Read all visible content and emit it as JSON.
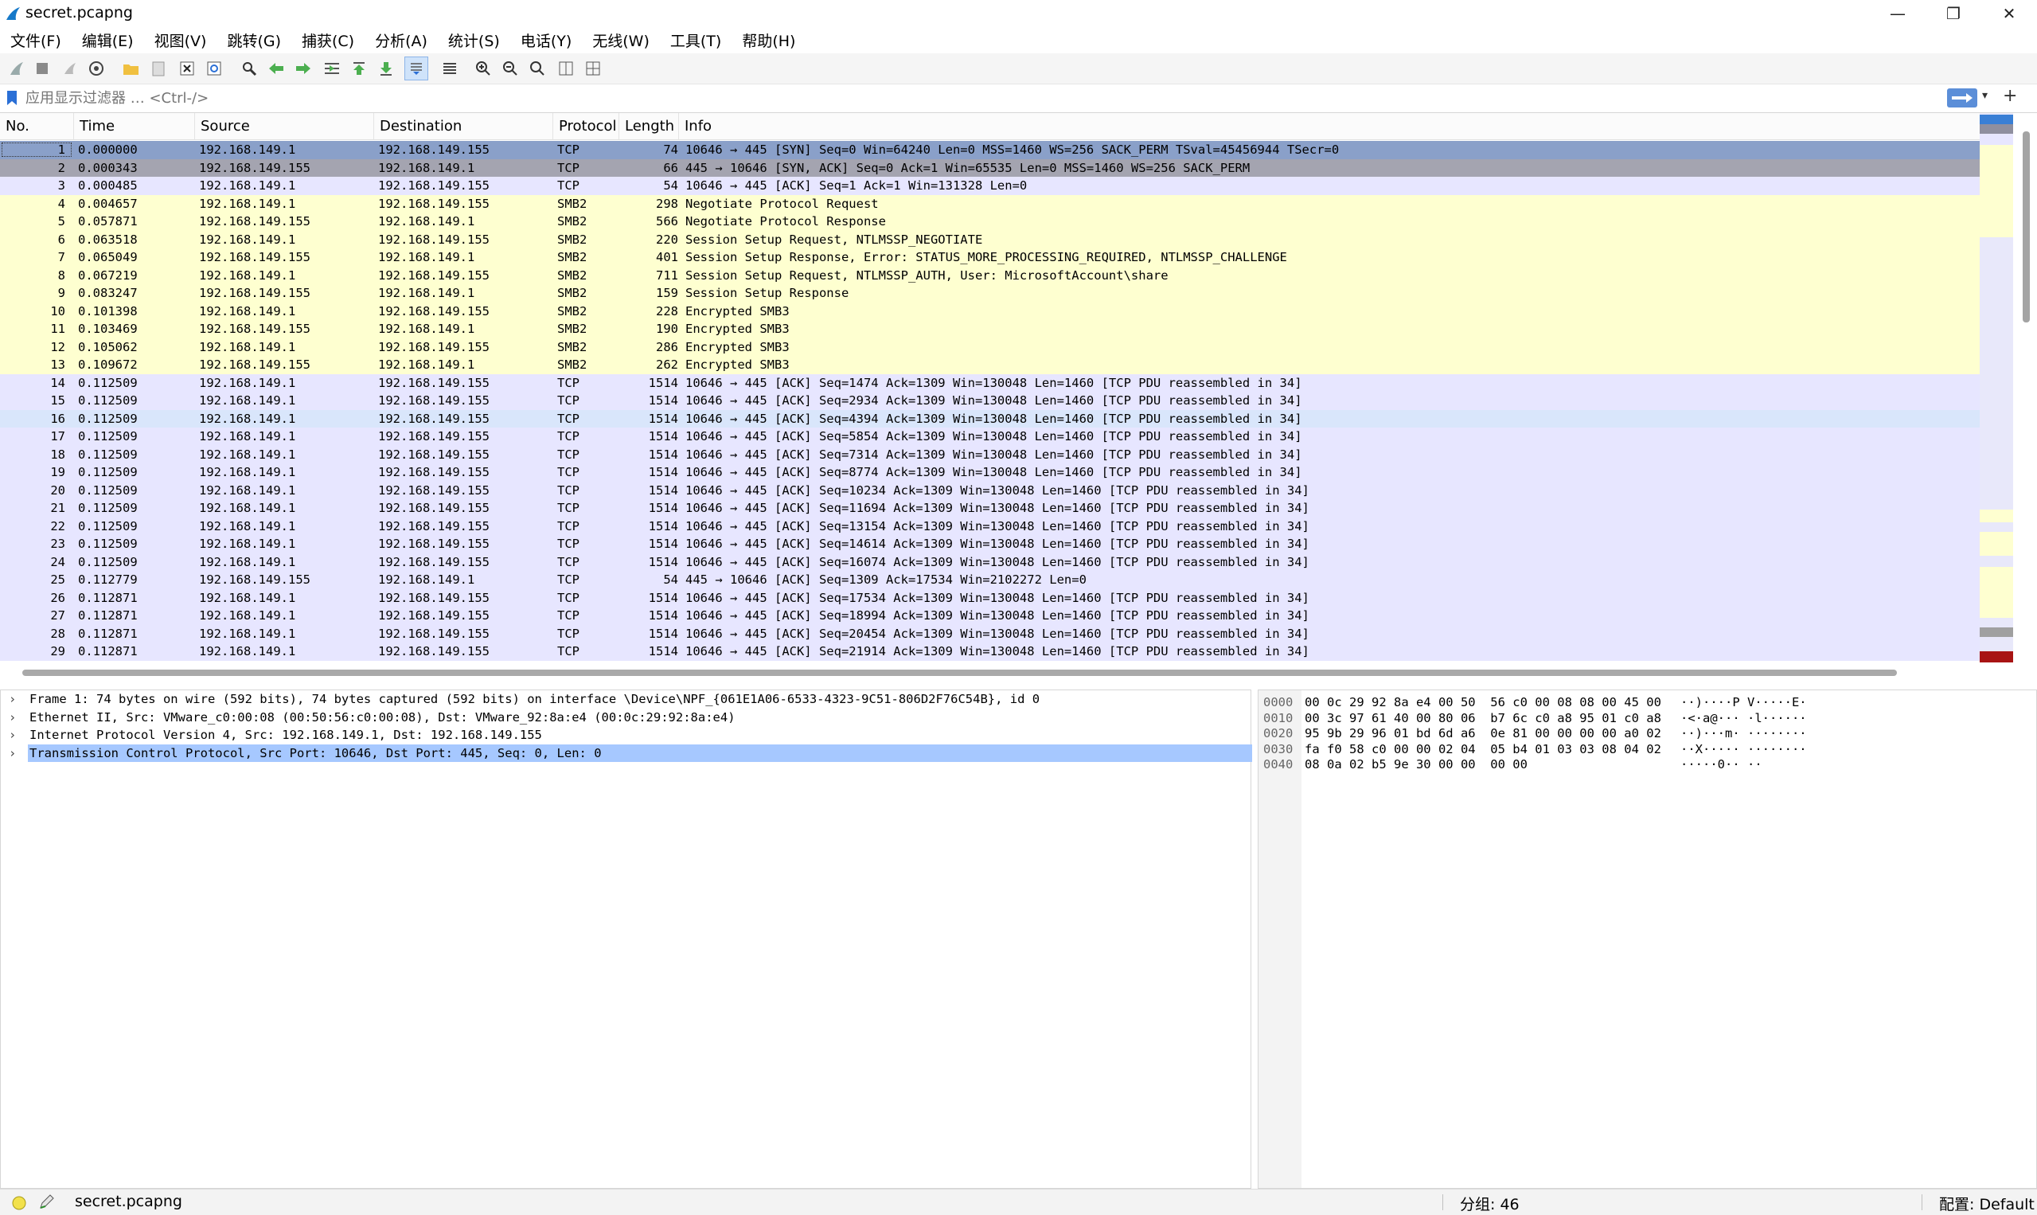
{
  "window": {
    "title": "secret.pcapng",
    "minimize": "—",
    "maximize": "❐",
    "close": "✕"
  },
  "menu": [
    "文件(F)",
    "编辑(E)",
    "视图(V)",
    "跳转(G)",
    "捕获(C)",
    "分析(A)",
    "统计(S)",
    "电话(Y)",
    "无线(W)",
    "工具(T)",
    "帮助(H)"
  ],
  "toolbar_icons": [
    "shark-fin-start-icon",
    "stop-icon",
    "restart-icon",
    "capture-options-icon",
    "open-folder-icon",
    "save-file-icon",
    "close-file-icon",
    "reload-icon",
    "find-icon",
    "back-arrow-icon",
    "forward-arrow-icon",
    "goto-packet-icon",
    "first-packet-icon",
    "last-packet-icon",
    "autoscroll-icon",
    "colorize-icon",
    "zoom-in-icon",
    "zoom-out-icon",
    "zoom-normal-icon",
    "resize-columns-icon",
    "layout-icon"
  ],
  "filter": {
    "placeholder": "应用显示过滤器 … <Ctrl-/>",
    "plus": "+"
  },
  "columns": {
    "no": "No.",
    "time": "Time",
    "source": "Source",
    "destination": "Destination",
    "protocol": "Protocol",
    "length": "Length",
    "info": "Info"
  },
  "packets": [
    {
      "no": "1",
      "time": "0.000000",
      "src": "192.168.149.1",
      "dst": "192.168.149.155",
      "proto": "TCP",
      "len": "74",
      "info": "10646 → 445 [SYN] Seq=0 Win=64240 Len=0 MSS=1460 WS=256 SACK_PERM TSval=45456944 TSecr=0"
    },
    {
      "no": "2",
      "time": "0.000343",
      "src": "192.168.149.155",
      "dst": "192.168.149.1",
      "proto": "TCP",
      "len": "66",
      "info": "445 → 10646 [SYN, ACK] Seq=0 Ack=1 Win=65535 Len=0 MSS=1460 WS=256 SACK_PERM"
    },
    {
      "no": "3",
      "time": "0.000485",
      "src": "192.168.149.1",
      "dst": "192.168.149.155",
      "proto": "TCP",
      "len": "54",
      "info": "10646 → 445 [ACK] Seq=1 Ack=1 Win=131328 Len=0"
    },
    {
      "no": "4",
      "time": "0.004657",
      "src": "192.168.149.1",
      "dst": "192.168.149.155",
      "proto": "SMB2",
      "len": "298",
      "info": "Negotiate Protocol Request"
    },
    {
      "no": "5",
      "time": "0.057871",
      "src": "192.168.149.155",
      "dst": "192.168.149.1",
      "proto": "SMB2",
      "len": "566",
      "info": "Negotiate Protocol Response"
    },
    {
      "no": "6",
      "time": "0.063518",
      "src": "192.168.149.1",
      "dst": "192.168.149.155",
      "proto": "SMB2",
      "len": "220",
      "info": "Session Setup Request, NTLMSSP_NEGOTIATE"
    },
    {
      "no": "7",
      "time": "0.065049",
      "src": "192.168.149.155",
      "dst": "192.168.149.1",
      "proto": "SMB2",
      "len": "401",
      "info": "Session Setup Response, Error: STATUS_MORE_PROCESSING_REQUIRED, NTLMSSP_CHALLENGE"
    },
    {
      "no": "8",
      "time": "0.067219",
      "src": "192.168.149.1",
      "dst": "192.168.149.155",
      "proto": "SMB2",
      "len": "711",
      "info": "Session Setup Request, NTLMSSP_AUTH, User: MicrosoftAccount\\share"
    },
    {
      "no": "9",
      "time": "0.083247",
      "src": "192.168.149.155",
      "dst": "192.168.149.1",
      "proto": "SMB2",
      "len": "159",
      "info": "Session Setup Response"
    },
    {
      "no": "10",
      "time": "0.101398",
      "src": "192.168.149.1",
      "dst": "192.168.149.155",
      "proto": "SMB2",
      "len": "228",
      "info": "Encrypted SMB3"
    },
    {
      "no": "11",
      "time": "0.103469",
      "src": "192.168.149.155",
      "dst": "192.168.149.1",
      "proto": "SMB2",
      "len": "190",
      "info": "Encrypted SMB3"
    },
    {
      "no": "12",
      "time": "0.105062",
      "src": "192.168.149.1",
      "dst": "192.168.149.155",
      "proto": "SMB2",
      "len": "286",
      "info": "Encrypted SMB3"
    },
    {
      "no": "13",
      "time": "0.109672",
      "src": "192.168.149.155",
      "dst": "192.168.149.1",
      "proto": "SMB2",
      "len": "262",
      "info": "Encrypted SMB3"
    },
    {
      "no": "14",
      "time": "0.112509",
      "src": "192.168.149.1",
      "dst": "192.168.149.155",
      "proto": "TCP",
      "len": "1514",
      "info": "10646 → 445 [ACK] Seq=1474 Ack=1309 Win=130048 Len=1460 [TCP PDU reassembled in 34]"
    },
    {
      "no": "15",
      "time": "0.112509",
      "src": "192.168.149.1",
      "dst": "192.168.149.155",
      "proto": "TCP",
      "len": "1514",
      "info": "10646 → 445 [ACK] Seq=2934 Ack=1309 Win=130048 Len=1460 [TCP PDU reassembled in 34]"
    },
    {
      "no": "16",
      "time": "0.112509",
      "src": "192.168.149.1",
      "dst": "192.168.149.155",
      "proto": "TCP",
      "len": "1514",
      "info": "10646 → 445 [ACK] Seq=4394 Ack=1309 Win=130048 Len=1460 [TCP PDU reassembled in 34]"
    },
    {
      "no": "17",
      "time": "0.112509",
      "src": "192.168.149.1",
      "dst": "192.168.149.155",
      "proto": "TCP",
      "len": "1514",
      "info": "10646 → 445 [ACK] Seq=5854 Ack=1309 Win=130048 Len=1460 [TCP PDU reassembled in 34]"
    },
    {
      "no": "18",
      "time": "0.112509",
      "src": "192.168.149.1",
      "dst": "192.168.149.155",
      "proto": "TCP",
      "len": "1514",
      "info": "10646 → 445 [ACK] Seq=7314 Ack=1309 Win=130048 Len=1460 [TCP PDU reassembled in 34]"
    },
    {
      "no": "19",
      "time": "0.112509",
      "src": "192.168.149.1",
      "dst": "192.168.149.155",
      "proto": "TCP",
      "len": "1514",
      "info": "10646 → 445 [ACK] Seq=8774 Ack=1309 Win=130048 Len=1460 [TCP PDU reassembled in 34]"
    },
    {
      "no": "20",
      "time": "0.112509",
      "src": "192.168.149.1",
      "dst": "192.168.149.155",
      "proto": "TCP",
      "len": "1514",
      "info": "10646 → 445 [ACK] Seq=10234 Ack=1309 Win=130048 Len=1460 [TCP PDU reassembled in 34]"
    },
    {
      "no": "21",
      "time": "0.112509",
      "src": "192.168.149.1",
      "dst": "192.168.149.155",
      "proto": "TCP",
      "len": "1514",
      "info": "10646 → 445 [ACK] Seq=11694 Ack=1309 Win=130048 Len=1460 [TCP PDU reassembled in 34]"
    },
    {
      "no": "22",
      "time": "0.112509",
      "src": "192.168.149.1",
      "dst": "192.168.149.155",
      "proto": "TCP",
      "len": "1514",
      "info": "10646 → 445 [ACK] Seq=13154 Ack=1309 Win=130048 Len=1460 [TCP PDU reassembled in 34]"
    },
    {
      "no": "23",
      "time": "0.112509",
      "src": "192.168.149.1",
      "dst": "192.168.149.155",
      "proto": "TCP",
      "len": "1514",
      "info": "10646 → 445 [ACK] Seq=14614 Ack=1309 Win=130048 Len=1460 [TCP PDU reassembled in 34]"
    },
    {
      "no": "24",
      "time": "0.112509",
      "src": "192.168.149.1",
      "dst": "192.168.149.155",
      "proto": "TCP",
      "len": "1514",
      "info": "10646 → 445 [ACK] Seq=16074 Ack=1309 Win=130048 Len=1460 [TCP PDU reassembled in 34]"
    },
    {
      "no": "25",
      "time": "0.112779",
      "src": "192.168.149.155",
      "dst": "192.168.149.1",
      "proto": "TCP",
      "len": "54",
      "info": "445 → 10646 [ACK] Seq=1309 Ack=17534 Win=2102272 Len=0"
    },
    {
      "no": "26",
      "time": "0.112871",
      "src": "192.168.149.1",
      "dst": "192.168.149.155",
      "proto": "TCP",
      "len": "1514",
      "info": "10646 → 445 [ACK] Seq=17534 Ack=1309 Win=130048 Len=1460 [TCP PDU reassembled in 34]"
    },
    {
      "no": "27",
      "time": "0.112871",
      "src": "192.168.149.1",
      "dst": "192.168.149.155",
      "proto": "TCP",
      "len": "1514",
      "info": "10646 → 445 [ACK] Seq=18994 Ack=1309 Win=130048 Len=1460 [TCP PDU reassembled in 34]"
    },
    {
      "no": "28",
      "time": "0.112871",
      "src": "192.168.149.1",
      "dst": "192.168.149.155",
      "proto": "TCP",
      "len": "1514",
      "info": "10646 → 445 [ACK] Seq=20454 Ack=1309 Win=130048 Len=1460 [TCP PDU reassembled in 34]"
    },
    {
      "no": "29",
      "time": "0.112871",
      "src": "192.168.149.1",
      "dst": "192.168.149.155",
      "proto": "TCP",
      "len": "1514",
      "info": "10646 → 445 [ACK] Seq=21914 Ack=1309 Win=130048 Len=1460 [TCP PDU reassembled in 34]"
    }
  ],
  "selected_packet": "1",
  "details": [
    "Frame 1: 74 bytes on wire (592 bits), 74 bytes captured (592 bits) on interface \\Device\\NPF_{061E1A06-6533-4323-9C51-806D2F76C54B}, id 0",
    "Ethernet II, Src: VMware_c0:00:08 (00:50:56:c0:00:08), Dst: VMware_92:8a:e4 (00:0c:29:92:8a:e4)",
    "Internet Protocol Version 4, Src: 192.168.149.1, Dst: 192.168.149.155",
    "Transmission Control Protocol, Src Port: 10646, Dst Port: 445, Seq: 0, Len: 0"
  ],
  "bytes": [
    {
      "offset": "0000",
      "hex": "00 0c 29 92 8a e4 00 50  56 c0 00 08 08 00 45 00",
      "ascii": "··)····P V·····E·"
    },
    {
      "offset": "0010",
      "hex": "00 3c 97 61 40 00 80 06  b7 6c c0 a8 95 01 c0 a8",
      "ascii": "·<·a@··· ·l······"
    },
    {
      "offset": "0020",
      "hex": "95 9b 29 96 01 bd 6d a6  0e 81 00 00 00 00 a0 02",
      "ascii": "··)···m· ········"
    },
    {
      "offset": "0030",
      "hex": "fa f0 58 c0 00 00 02 04  05 b4 01 03 03 08 04 02",
      "ascii": "··X····· ········"
    },
    {
      "offset": "0040",
      "hex": "08 0a 02 b5 9e 30 00 00  00 00",
      "ascii": "·····0·· ··"
    }
  ],
  "status": {
    "file": "secret.pcapng",
    "packets": "分组: 46",
    "profile": "配置: Default"
  },
  "colors": {
    "tcp_row": "#e7e6ff",
    "smb_row": "#feffd0",
    "selected_row": "#8aa0c9",
    "detail_selected": "#a6c8ff"
  }
}
